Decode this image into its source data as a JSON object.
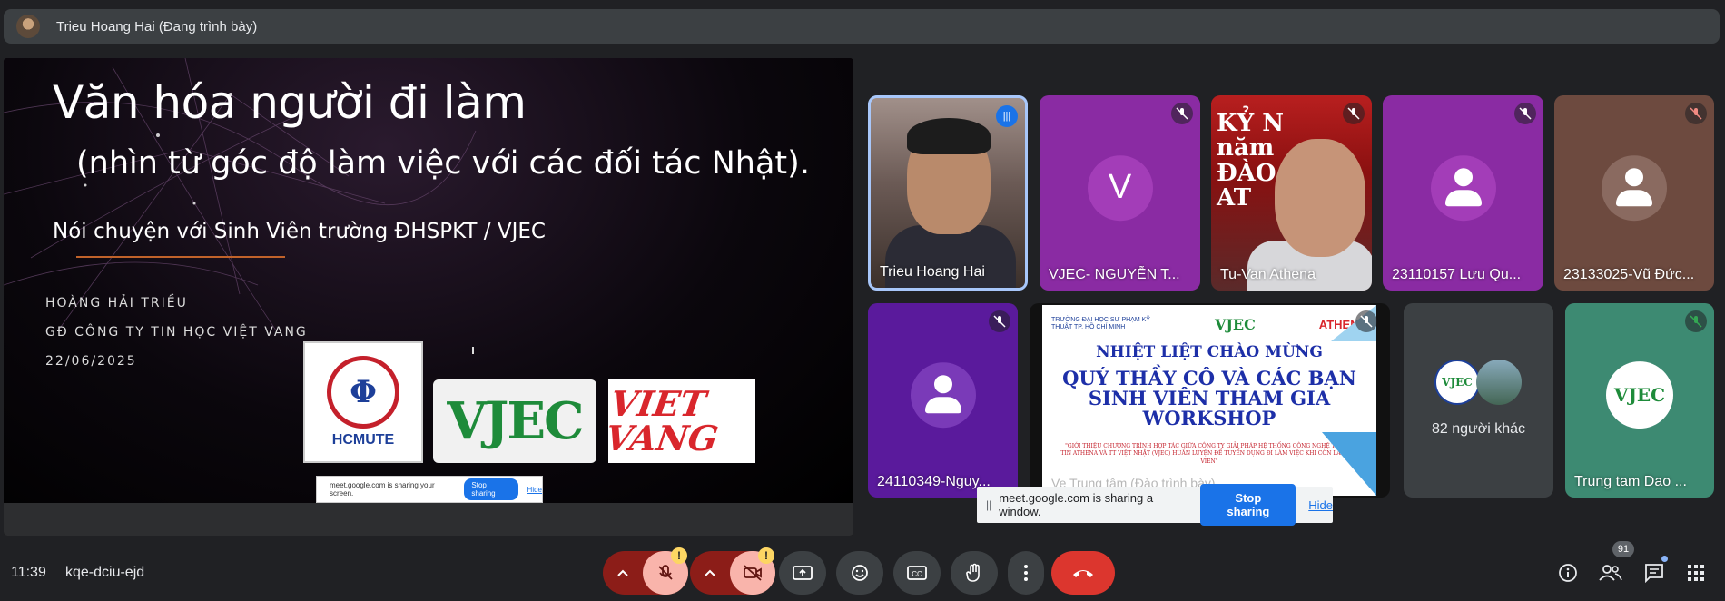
{
  "presenter": {
    "name": "Trieu Hoang Hai (Đang trình bày)"
  },
  "slide": {
    "title": "Văn hóa người đi làm",
    "subtitle": "(nhìn từ góc độ làm việc với các đối tác Nhật).",
    "talk": "Nói chuyện với Sinh Viên trường ĐHSPKT / VJEC",
    "author_name": "HOÀNG HẢI TRIỀU",
    "author_role": "GĐ CÔNG TY TIN HỌC VIỆT VANG",
    "date": "22/06/2025",
    "logo_hcmute": "HCMUTE",
    "logo_vjec": "VJEC",
    "logo_vietvang": "VIET VANG",
    "inner_share_text": "meet.google.com is sharing your screen.",
    "inner_stop": "Stop sharing",
    "inner_hide": "Hide"
  },
  "tiles": [
    {
      "name": "Trieu Hoang Hai"
    },
    {
      "name": "VJEC- NGUYỄN T...",
      "initial": "V"
    },
    {
      "name": "Tu-Van Athena",
      "backdrop": "KỶ N\nnăm\nĐÀO TẠO\nAT"
    },
    {
      "name": "23110157 Lưu Qu..."
    },
    {
      "name": "23133025-Vũ Đức..."
    },
    {
      "name": "24110349-Nguy..."
    },
    {
      "name": "Ve Trung tâm (Đào trình bày)"
    },
    {
      "name": "82 người khác"
    },
    {
      "name": "Trung tam Dao ...",
      "logo": "VJEC"
    }
  ],
  "banner": {
    "hcmute_caption": "TRƯỜNG ĐẠI HỌC SƯ PHẠM KỸ THUẬT TP. HỒ CHÍ MINH",
    "vjec": "VJEC",
    "athena": "ATHENA",
    "line1": "NHIỆT LIỆT CHÀO MỪNG",
    "line2": "QUÝ THẦY CÔ VÀ CÁC BẠN",
    "line3": "SINH VIÊN THAM GIA",
    "line4": "WORKSHOP",
    "small": "\"GIỚI THIỆU CHƯƠNG TRÌNH HỢP TÁC GIỮA CÔNG TY GIẢI PHÁP HỆ THỐNG CÔNG NGHỆ THÔNG TIN ATHENA VÀ TT VIỆT NHẬT (VJEC) HUẤN LUYỆN ĐỂ TUYỂN DỤNG ĐI LÀM VIỆC KHI CÒN LÀ SINH VIÊN\""
  },
  "others_logo": "VJEC",
  "share_notice": {
    "grip": "||",
    "text": "meet.google.com is sharing a window.",
    "stop": "Stop sharing",
    "hide": "Hide"
  },
  "bottom": {
    "time": "11:39",
    "code": "kqe-dciu-ejd",
    "participant_count": "91"
  },
  "icons": {
    "chevron": "^",
    "mic_off": "🎙",
    "cam_off": "▨",
    "present": "⬆",
    "emoji": "☺",
    "captions": "CC",
    "hand": "✋",
    "more": "⋮",
    "leave": "☎",
    "info": "ⓘ",
    "people": "👥",
    "chat": "💬",
    "activities": "⁝⁝",
    "warn": "!",
    "muted": "🚫",
    "speaking": "|||"
  },
  "colors": {
    "leave": "#dc362e",
    "mic_off_bg": "#f9b4ab",
    "stop_share": "#1a73e8",
    "active_tile_border": "#a8c7fa"
  }
}
